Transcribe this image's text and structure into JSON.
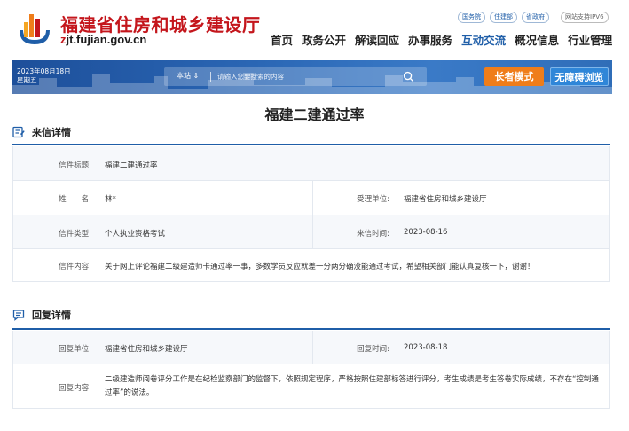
{
  "site": {
    "title": "福建省住房和城乡建设厅",
    "domain_prefix": "z",
    "domain_rest": "jt.fujian.gov.cn"
  },
  "top_links": [
    "国务院",
    "住建部",
    "省政府",
    "网站支持IPV6"
  ],
  "nav": [
    "首页",
    "政务公开",
    "解读回应",
    "办事服务",
    "互动交流",
    "概况信息",
    "行业管理"
  ],
  "nav_active": "互动交流",
  "banner": {
    "date": "2023年08月18日",
    "weekday": "星期五",
    "search_scope": "本站 ⇕",
    "search_placeholder": "请输入您要搜索的内容",
    "elder_mode": "长者模式",
    "accessible": "无障碍浏览"
  },
  "page_title": "福建二建通过率",
  "letter": {
    "heading": "来信详情",
    "subject_label": "信件标题:",
    "subject": "福建二建通过率",
    "name_label": "姓　　名:",
    "name": "林*",
    "dept_label": "受理单位:",
    "dept": "福建省住房和城乡建设厅",
    "type_label": "信件类型:",
    "type": "个人执业资格考试",
    "date_label": "来信时间:",
    "date": "2023-08-16",
    "content_label": "信件内容:",
    "content": "关于网上评论福建二级建造师卡通过率一事，多数学员反应就差一分两分确没能通过考试，希望相关部门能认真复核一下，谢谢！"
  },
  "reply": {
    "heading": "回复详情",
    "unit_label": "回复单位:",
    "unit": "福建省住房和城乡建设厅",
    "time_label": "回复时间:",
    "time": "2023-08-18",
    "content_label": "回复内容:",
    "content": "二级建造师阅卷评分工作是在纪检监察部门的监督下，依照规定程序，严格按照住建部标答进行评分，考生成绩是考生答卷实际成绩，不存在“控制通过率”的说法。"
  },
  "colors": {
    "brand_red": "#c4161c",
    "brand_blue": "#1f5ea8",
    "elder_orange": "#ef7d1a"
  }
}
